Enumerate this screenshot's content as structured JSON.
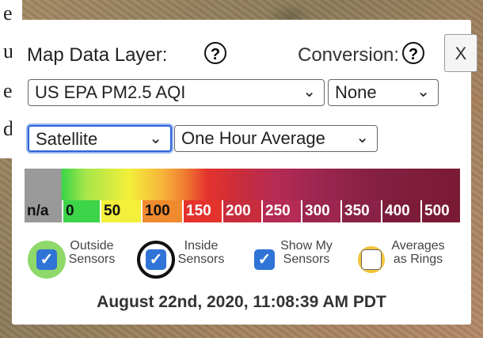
{
  "background_text": [
    "e",
    "u",
    "e",
    "d"
  ],
  "panel": {
    "map_layer_label": "Map Data Layer:",
    "conversion_label": "Conversion:",
    "help_glyph": "?",
    "close_label": "X",
    "selects": {
      "data_layer": "US EPA PM2.5 AQI",
      "conversion": "None",
      "map_type": "Satellite",
      "average": "One Hour Average"
    },
    "scale": {
      "labels": [
        "n/a",
        "0",
        "50",
        "100",
        "150",
        "200",
        "250",
        "300",
        "350",
        "400",
        "500"
      ],
      "colors": [
        "#999999",
        "#3dd44a",
        "#f3ef3a",
        "#f08a2e",
        "#e4322d",
        "#c82d3d",
        "#b42b55",
        "#9c2650",
        "#8a2248",
        "#7d1c3a",
        "#7a1a35"
      ]
    },
    "toggles": [
      {
        "label_line1": "Outside",
        "label_line2": "Sensors",
        "checked": true,
        "ring_color": "#8fd86a"
      },
      {
        "label_line1": "Inside",
        "label_line2": "Sensors",
        "checked": true,
        "ring_color": "#111111"
      },
      {
        "label_line1": "Show My",
        "label_line2": "Sensors",
        "checked": true
      },
      {
        "label_line1": "Averages",
        "label_line2": "as Rings",
        "checked": false,
        "ring_color": "#f3c43a"
      }
    ],
    "timestamp": "August 22nd, 2020, 11:08:39 AM PDT"
  }
}
